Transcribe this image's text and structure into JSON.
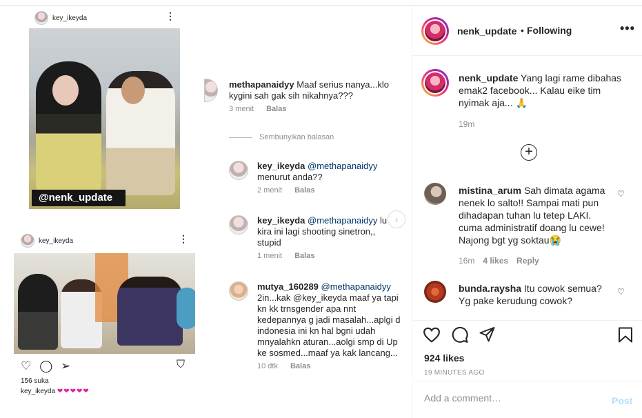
{
  "media": {
    "post1": {
      "username": "key_ikeyda",
      "watermark": "@nenk_update"
    },
    "post2": {
      "username": "key_ikeyda",
      "likes": "156 suka",
      "caption_user": "key_ikeyda",
      "caption_hearts": "❤❤❤❤❤"
    },
    "comments": [
      {
        "user": "methapanaidyy",
        "mention": "",
        "text": "Maaf serius nanya...klo kygini sah gak sih nikahnya???",
        "time": "3 menit",
        "reply": "Balas"
      },
      {
        "user": "key_ikeyda",
        "mention": "@methapanaidyy",
        "text": "menurut anda??",
        "time": "2 menit",
        "reply": "Balas"
      },
      {
        "user": "key_ikeyda",
        "mention": "@methapanaidyy",
        "text": "lu kira ini lagi shooting sinetron,, stupid",
        "time": "1 menit",
        "reply": "Balas"
      },
      {
        "user": "mutya_160289",
        "mention": "@methapanaidyy",
        "text": "2in...kak @key_ikeyda maaf ya tapi kn kk trnsgender apa nnt kedepannya g jadi masalah...aplgi d indonesia ini kn hal bgni udah mnyalahkn aturan...aolgi smp di Up ke sosmed...maaf ya kak lancang...",
        "time": "10 dtk",
        "reply": "Balas"
      }
    ],
    "hide_replies": "Sembunyikan balasan"
  },
  "header": {
    "username": "nenk_update",
    "separator": "•",
    "follow_status": "Following",
    "more": "•••"
  },
  "caption": {
    "username": "nenk_update",
    "text": "Yang lagi rame dibahas emak2 facebook... Kalau eike tim nyimak aja... 🙏",
    "time": "19m"
  },
  "comments": [
    {
      "username": "mistina_arum",
      "text": "Sah dimata agama nenek lo salto!! Sampai mati pun dihadapan tuhan lu tetep LAKI. cuma administratif doang lu cewe! Najong bgt yg soktau😭",
      "time": "16m",
      "likes": "4 likes",
      "reply": "Reply"
    },
    {
      "username": "bunda.raysha",
      "text": "Itu cowok semua? Yg pake kerudung cowok?"
    }
  ],
  "actions": {
    "likes": "924 likes",
    "timestamp": "19 MINUTES AGO"
  },
  "add_comment": {
    "placeholder": "Add a comment…",
    "post_label": "Post"
  },
  "colors": {
    "accent": "#0095f6",
    "post_disabled": "#b2dffc",
    "muted": "#8e8e8e",
    "mention": "#00376b"
  },
  "icons": [
    "heart-icon",
    "comment-icon",
    "share-icon",
    "bookmark-icon",
    "more-icon",
    "add-circle-icon"
  ]
}
